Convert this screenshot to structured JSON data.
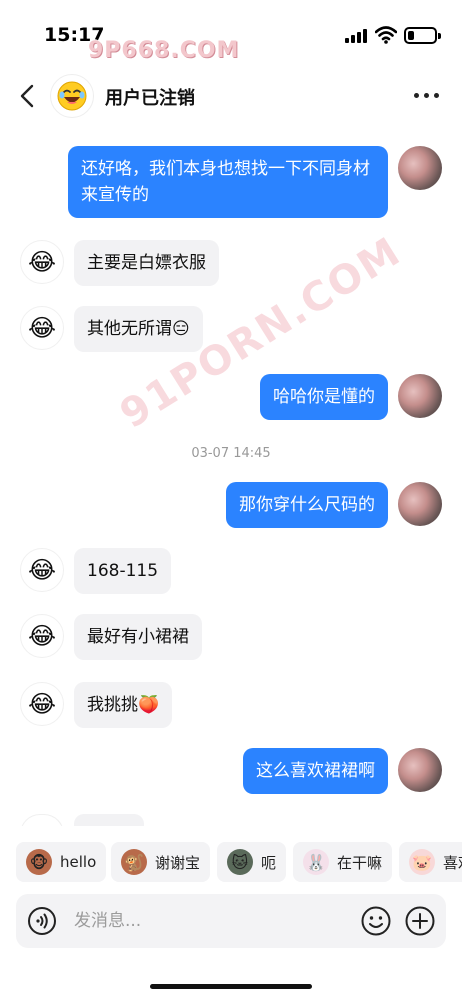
{
  "status": {
    "time": "15:17",
    "watermark": "9P668.COM",
    "battery_level": 0.25
  },
  "nav": {
    "title": "用户已注销",
    "avatar_icon": "laughing-emoji-icon"
  },
  "watermark_diag": "91PORN.COM",
  "messages": [
    {
      "side": "out",
      "text": "还好咯，我们本身也想找一下不同身材来宣传的"
    },
    {
      "side": "in",
      "text": "主要是白嫖衣服"
    },
    {
      "side": "in",
      "text": "其他无所谓😑"
    },
    {
      "side": "out",
      "text": "哈哈你是懂的"
    },
    {
      "side": "time",
      "text": "03-07 14:45"
    },
    {
      "side": "out",
      "text": "那你穿什么尺码的"
    },
    {
      "side": "in",
      "text": "168-115"
    },
    {
      "side": "in",
      "text": "最好有小裙裙"
    },
    {
      "side": "in",
      "text": "我挑挑🍑"
    },
    {
      "side": "out",
      "text": "这么喜欢裙裙啊"
    }
  ],
  "quick_replies": [
    {
      "label": "hello",
      "icon": "monkey-sticker-icon"
    },
    {
      "label": "谢谢宝",
      "icon": "monkey-bow-sticker-icon"
    },
    {
      "label": "呃",
      "icon": "cat-sticker-icon"
    },
    {
      "label": "在干嘛",
      "icon": "bunny-sticker-icon"
    },
    {
      "label": "喜欢",
      "icon": "pig-sticker-icon"
    }
  ],
  "input": {
    "placeholder": "发消息..."
  },
  "colors": {
    "accent": "#2b83ff",
    "bubble_in": "#f2f2f4",
    "chip_bg": "#f3f3f5"
  }
}
